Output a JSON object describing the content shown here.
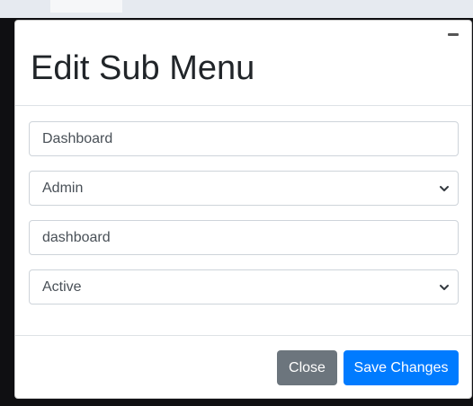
{
  "modal": {
    "title": "Edit Sub Menu"
  },
  "form": {
    "title_input": {
      "value": "Dashboard"
    },
    "menu_select": {
      "selected": "Admin"
    },
    "url_input": {
      "value": "dashboard"
    },
    "status_select": {
      "selected": "Active"
    }
  },
  "footer": {
    "close_label": "Close",
    "save_label": "Save Changes"
  },
  "colors": {
    "primary": "#007bff",
    "secondary": "#6c757d",
    "backdrop": "#0f0f12"
  },
  "icons": {
    "header_close": "minimize-icon",
    "select_arrow": "chevron-down-icon"
  }
}
